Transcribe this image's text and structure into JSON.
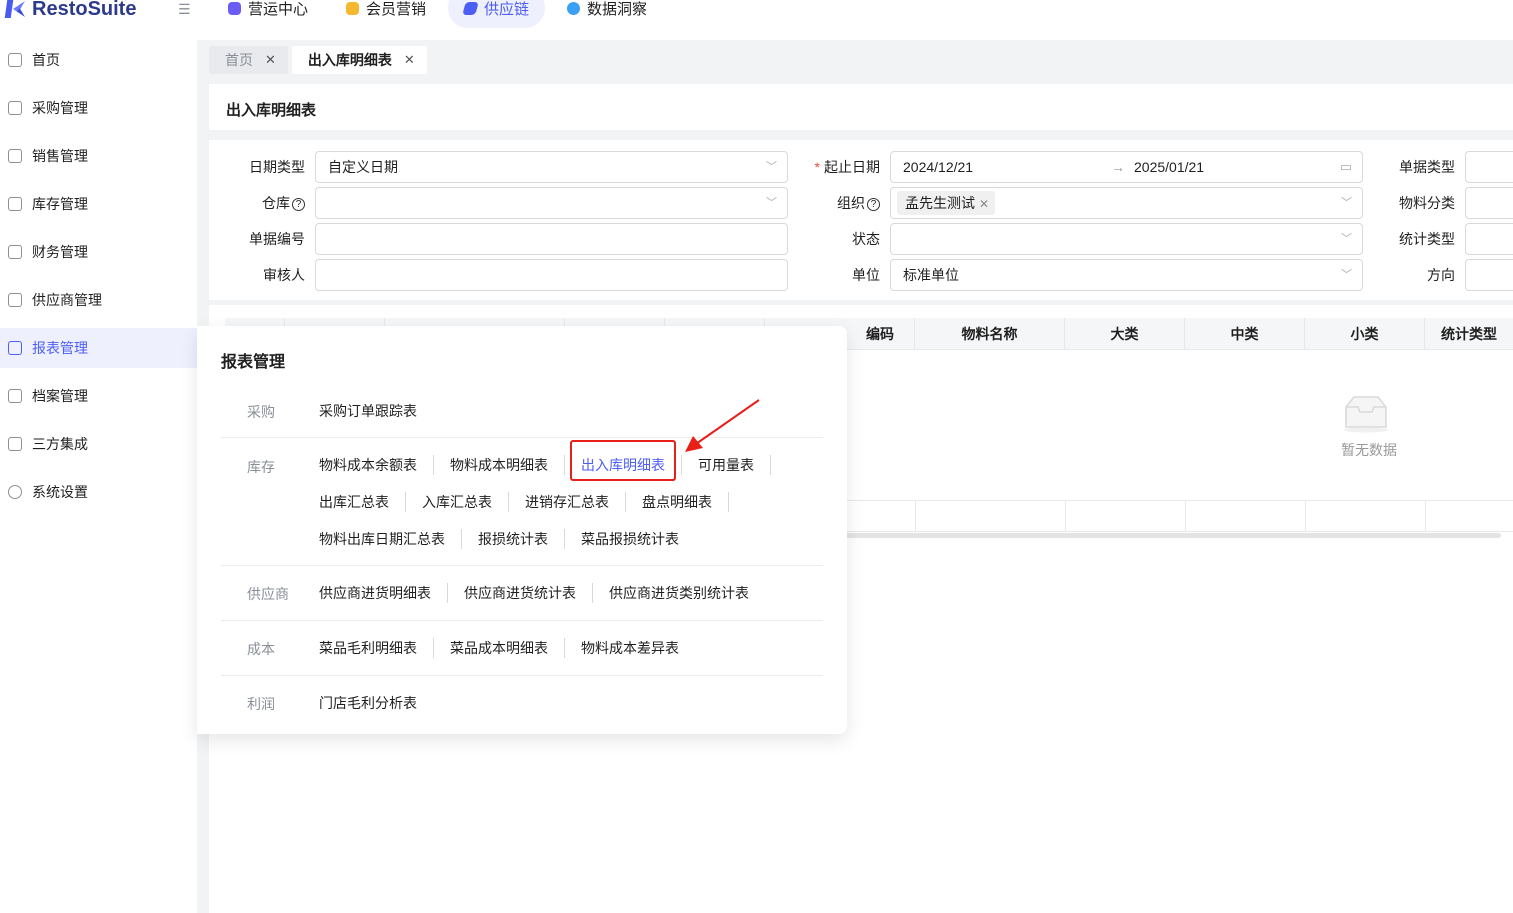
{
  "brand": "RestoSuite",
  "topnav": [
    {
      "label": "营运中心",
      "color": "#6b5cf5"
    },
    {
      "label": "会员营销",
      "color": "#f5b82e"
    },
    {
      "label": "供应链",
      "color": "#4d5ef5"
    },
    {
      "label": "数据洞察",
      "color": "#3aa0f5"
    }
  ],
  "sidebar": [
    {
      "label": "首页"
    },
    {
      "label": "采购管理"
    },
    {
      "label": "销售管理"
    },
    {
      "label": "库存管理"
    },
    {
      "label": "财务管理"
    },
    {
      "label": "供应商管理"
    },
    {
      "label": "报表管理"
    },
    {
      "label": "档案管理"
    },
    {
      "label": "三方集成"
    },
    {
      "label": "系统设置"
    }
  ],
  "tabs": [
    {
      "label": "首页"
    },
    {
      "label": "出入库明细表"
    }
  ],
  "page_title": "出入库明细表",
  "filters": {
    "date_type_label": "日期类型",
    "date_type_value": "自定义日期",
    "warehouse_label": "仓库",
    "doc_no_label": "单据编号",
    "auditor_label": "审核人",
    "date_range_label": "起止日期",
    "date_start": "2024/12/21",
    "date_end": "2025/01/21",
    "org_label": "组织",
    "org_tag": "孟先生测试",
    "status_label": "状态",
    "unit_label": "单位",
    "unit_value": "标准单位",
    "doc_type_label": "单据类型",
    "material_cat_label": "物料分类",
    "stat_type_label": "统计类型",
    "direction_label": "方向"
  },
  "table": {
    "headers": [
      "编码",
      "物料名称",
      "大类",
      "中类",
      "小类",
      "统计类型"
    ],
    "empty_text": "暂无数据"
  },
  "popover": {
    "title": "报表管理",
    "groups": [
      {
        "category": "采购",
        "links": [
          "采购订单跟踪表"
        ]
      },
      {
        "category": "库存",
        "links": [
          "物料成本余额表",
          "物料成本明细表",
          "出入库明细表",
          "可用量表",
          "出库汇总表",
          "入库汇总表",
          "进销存汇总表",
          "盘点明细表",
          "物料出库日期汇总表",
          "报损统计表",
          "菜品报损统计表"
        ]
      },
      {
        "category": "供应商",
        "links": [
          "供应商进货明细表",
          "供应商进货统计表",
          "供应商进货类别统计表"
        ]
      },
      {
        "category": "成本",
        "links": [
          "菜品毛利明细表",
          "菜品成本明细表",
          "物料成本差异表"
        ]
      },
      {
        "category": "利润",
        "links": [
          "门店毛利分析表"
        ]
      }
    ]
  }
}
